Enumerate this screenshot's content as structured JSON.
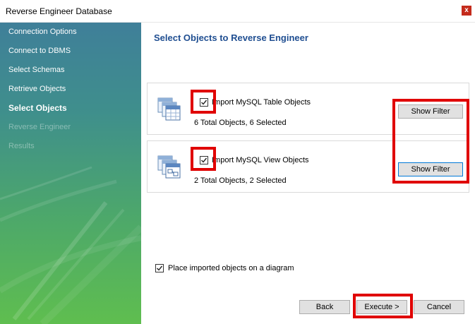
{
  "window": {
    "title": "Reverse Engineer Database",
    "close_label": "x"
  },
  "sidebar": {
    "steps": [
      {
        "label": "Connection Options",
        "state": "done"
      },
      {
        "label": "Connect to DBMS",
        "state": "done"
      },
      {
        "label": "Select Schemas",
        "state": "done"
      },
      {
        "label": "Retrieve Objects",
        "state": "done"
      },
      {
        "label": "Select Objects",
        "state": "current"
      },
      {
        "label": "Reverse Engineer",
        "state": "pending"
      },
      {
        "label": "Results",
        "state": "pending"
      }
    ]
  },
  "main": {
    "heading": "Select Objects to Reverse Engineer",
    "tables_panel": {
      "import_label": "Import MySQL Table Objects",
      "checked": true,
      "count_text": "6 Total Objects, 6 Selected",
      "filter_button": "Show Filter"
    },
    "views_panel": {
      "import_label": "Import MySQL View Objects",
      "checked": true,
      "count_text": "2 Total Objects, 2 Selected",
      "filter_button": "Show Filter"
    },
    "place_on_diagram": {
      "label": "Place imported objects on a diagram",
      "checked": true
    }
  },
  "footer": {
    "back": "Back",
    "execute": "Execute >",
    "cancel": "Cancel"
  },
  "colors": {
    "heading": "#1f4e91",
    "highlight": "#e00000",
    "close_button": "#c42b1c"
  },
  "icons": {
    "tables": "table-objects-icon",
    "views": "view-objects-icon",
    "check": "check-icon"
  }
}
